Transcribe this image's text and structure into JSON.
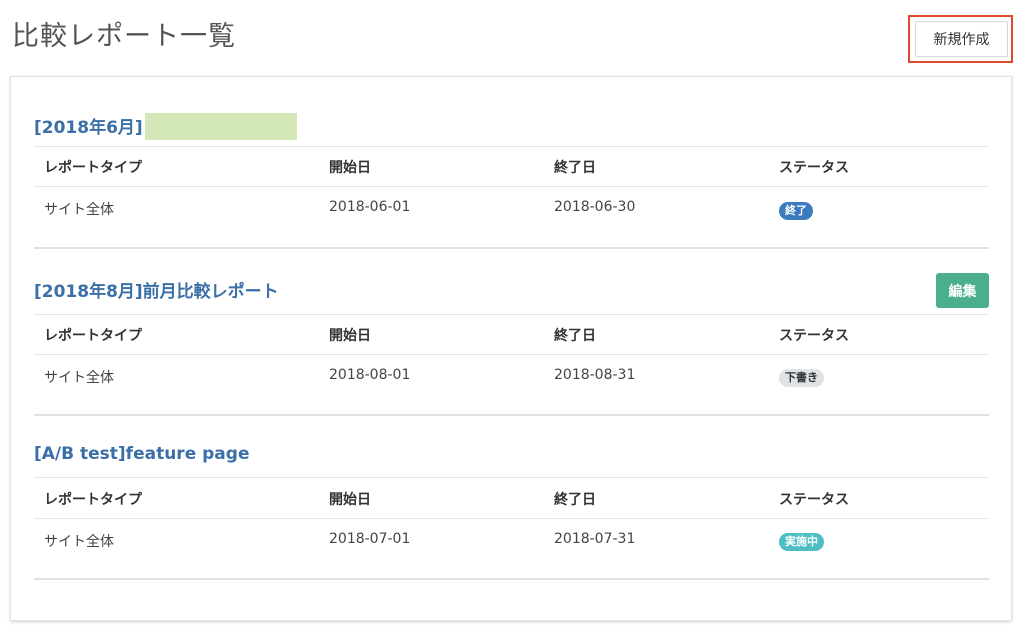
{
  "page": {
    "title": "比較レポート一覧",
    "new_button_label": "新規作成"
  },
  "columns": {
    "type": "レポートタイプ",
    "start": "開始日",
    "end": "終了日",
    "status": "ステータス"
  },
  "edit_label": "編集",
  "reports": [
    {
      "title": "[2018年6月]",
      "type": "サイト全体",
      "start": "2018-06-01",
      "end": "2018-06-30",
      "status": "終了",
      "status_bg": "#3a7bbf",
      "status_fg": "#ffffff"
    },
    {
      "title": "[2018年8月]前月比較レポート",
      "type": "サイト全体",
      "start": "2018-08-01",
      "end": "2018-08-31",
      "status": "下書き",
      "status_bg": "#dfe3e6",
      "status_fg": "#333333"
    },
    {
      "title": "[A/B test]feature page",
      "type": "サイト全体",
      "start": "2018-07-01",
      "end": "2018-07-31",
      "status": "実施中",
      "status_bg": "#4dbfc4",
      "status_fg": "#ffffff"
    }
  ],
  "colors": {
    "link": "#3a6fa8",
    "edit_button": "#4caf8b",
    "highlight_border": "#e04a2f"
  }
}
